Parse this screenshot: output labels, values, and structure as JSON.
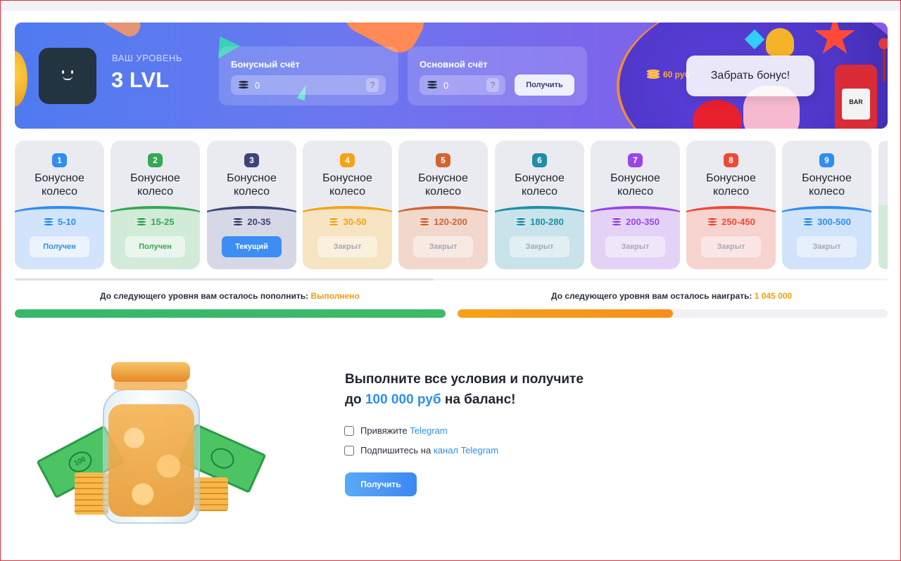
{
  "level": {
    "caption": "ВАШ УРОВЕНЬ",
    "value": "3 LVL"
  },
  "accounts": {
    "bonus": {
      "title": "Бонусный счёт",
      "value": "0",
      "help": "?"
    },
    "main": {
      "title": "Основной счёт",
      "value": "0",
      "help": "?",
      "button": "Получить"
    }
  },
  "promo": {
    "amount": "60 руб",
    "claim_button": "Забрать бонус!",
    "slot_text": "BAR"
  },
  "wheels": [
    {
      "num": "1",
      "name": "Бонусное колесо",
      "range": "5-10",
      "status": "Получен",
      "state": "done",
      "accent": "#2f8ef0",
      "bg": "#d2e4fb"
    },
    {
      "num": "2",
      "name": "Бонусное колесо",
      "range": "15-25",
      "status": "Получен",
      "state": "done",
      "accent": "#35a852",
      "bg": "#d1ebd8"
    },
    {
      "num": "3",
      "name": "Бонусное колесо",
      "range": "20-35",
      "status": "Текущий",
      "state": "current",
      "accent": "#3d4577",
      "bg": "#d6d8e6"
    },
    {
      "num": "4",
      "name": "Бонусное колесо",
      "range": "30-50",
      "status": "Закрыт",
      "state": "closed",
      "accent": "#f5a414",
      "bg": "#f6e4c2"
    },
    {
      "num": "5",
      "name": "Бонусное колесо",
      "range": "120-200",
      "status": "Закрыт",
      "state": "closed",
      "accent": "#d06534",
      "bg": "#f2d8cc"
    },
    {
      "num": "6",
      "name": "Бонусное колесо",
      "range": "180-280",
      "status": "Закрыт",
      "state": "closed",
      "accent": "#1e8fa8",
      "bg": "#c9e3ea"
    },
    {
      "num": "7",
      "name": "Бонусное колесо",
      "range": "200-350",
      "status": "Закрыт",
      "state": "closed",
      "accent": "#9a45e8",
      "bg": "#e4d2f6"
    },
    {
      "num": "8",
      "name": "Бонусное колесо",
      "range": "250-450",
      "status": "Закрыт",
      "state": "closed",
      "accent": "#ef4a36",
      "bg": "#f6d3cf"
    },
    {
      "num": "9",
      "name": "Бонусное колесо",
      "range": "300-500",
      "status": "Закрыт",
      "state": "closed",
      "accent": "#2f8ef0",
      "bg": "#d0e3fa"
    }
  ],
  "progress": {
    "deposit": {
      "label": "До следующего уровня вам осталось пополнить: ",
      "value": "Выполнено",
      "fraction": 1.0,
      "color": "#3dba68"
    },
    "wager": {
      "label": "До следующего уровня вам осталось наиграть: ",
      "value": "1 045 000",
      "fraction": 0.5,
      "color": "#f5901a"
    }
  },
  "offer": {
    "title_line1": "Выполните все условия и получите",
    "title_pre": "до ",
    "title_amount": "100 000 руб",
    "title_post": " на баланс!",
    "conditions": [
      {
        "text": "Привяжите ",
        "link": "Telegram"
      },
      {
        "text": "Подпишитесь на ",
        "link": "канал Telegram"
      }
    ],
    "button": "Получить"
  },
  "jar_labels": {
    "cash": "100"
  },
  "icons": {
    "coin": "coin-stack-icon",
    "help": "question-icon",
    "avatar": "smiley-icon"
  }
}
